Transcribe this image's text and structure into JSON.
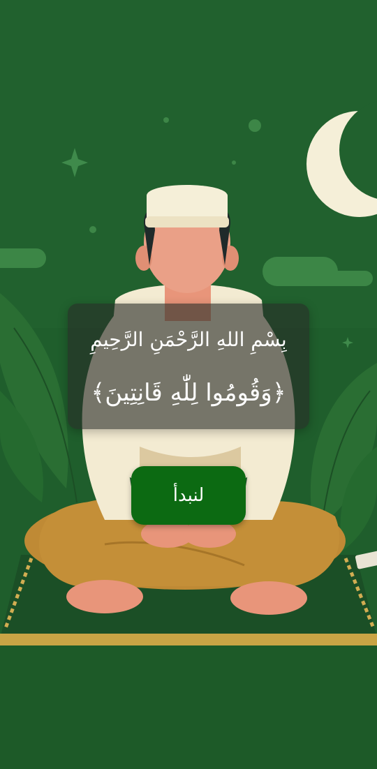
{
  "overlay": {
    "bismillah": "بِسْمِ اللهِ الرَّحْمَنِ الرَّحِيمِ",
    "verse": "﴿وَقُومُوا لِلّٰهِ قَانِتِينَ﴾"
  },
  "start_button": {
    "label": "لنبدأ"
  },
  "colors": {
    "background_green": "#1f5e2c",
    "button_green": "#0c6a12",
    "moon": "#f5efd8",
    "overlay": "rgba(40,45,40,0.62)"
  },
  "icons": [
    "crescent-moon-icon",
    "star-icon"
  ]
}
